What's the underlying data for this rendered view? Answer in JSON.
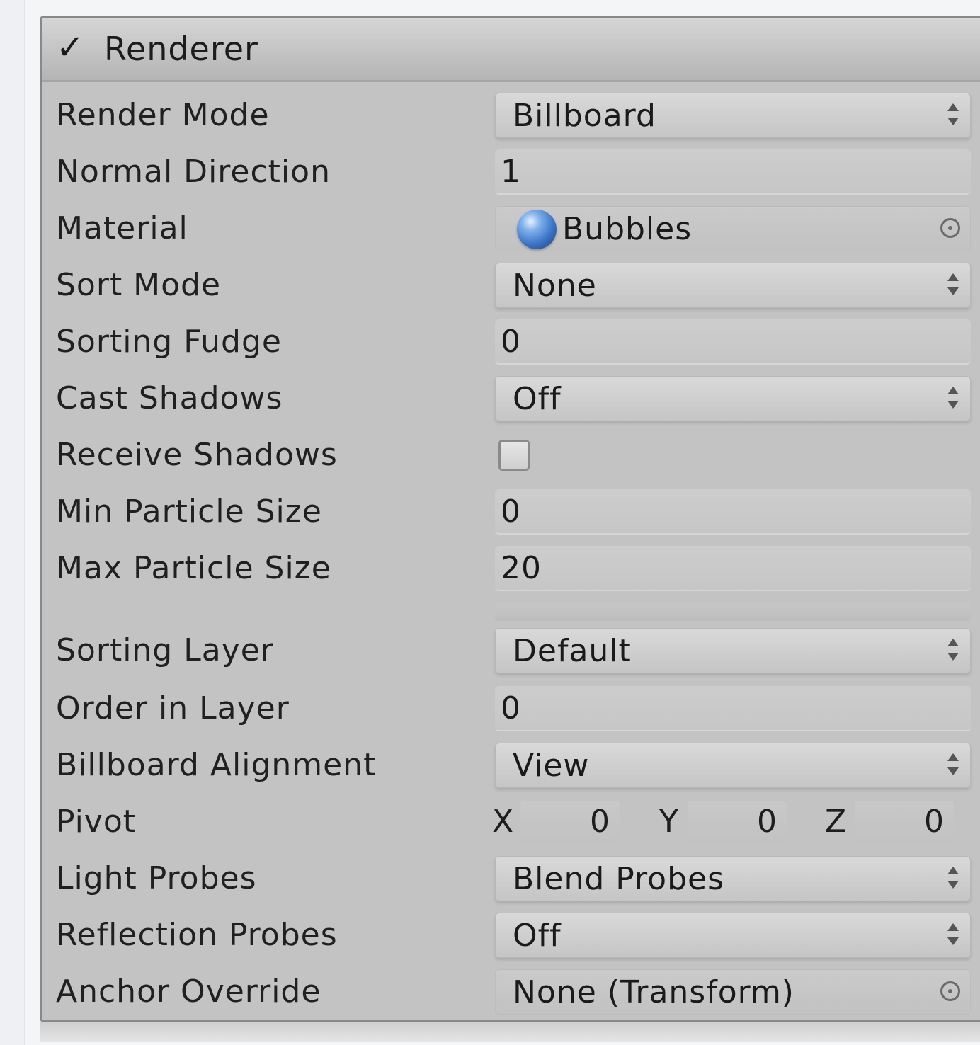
{
  "component": {
    "enabled_glyph": "✓",
    "title": "Renderer"
  },
  "rows": {
    "render_mode": {
      "label": "Render Mode",
      "value": "Billboard"
    },
    "normal_direction": {
      "label": "Normal Direction",
      "value": "1"
    },
    "material": {
      "label": "Material",
      "value": "Bubbles"
    },
    "sort_mode": {
      "label": "Sort Mode",
      "value": "None"
    },
    "sorting_fudge": {
      "label": "Sorting Fudge",
      "value": "0"
    },
    "cast_shadows": {
      "label": "Cast Shadows",
      "value": "Off"
    },
    "receive_shadows": {
      "label": "Receive Shadows",
      "checked": false
    },
    "min_particle_size": {
      "label": "Min Particle Size",
      "value": "0"
    },
    "max_particle_size": {
      "label": "Max Particle Size",
      "value": "20"
    },
    "sorting_layer": {
      "label": "Sorting Layer",
      "value": "Default"
    },
    "order_in_layer": {
      "label": "Order in Layer",
      "value": "0"
    },
    "billboard_alignment": {
      "label": "Billboard Alignment",
      "value": "View"
    },
    "pivot": {
      "label": "Pivot",
      "x_label": "X",
      "x": "0",
      "y_label": "Y",
      "y": "0",
      "z_label": "Z",
      "z": "0"
    },
    "light_probes": {
      "label": "Light Probes",
      "value": "Blend Probes"
    },
    "reflection_probes": {
      "label": "Reflection Probes",
      "value": "Off"
    },
    "anchor_override": {
      "label": "Anchor Override",
      "value": "None (Transform)"
    }
  },
  "icons": {
    "popup_arrows": "updown-arrows-icon",
    "object_picker": "object-picker-icon",
    "material_preview": "material-sphere-icon"
  },
  "colors": {
    "panel_bg": "#c3c3c3",
    "header_bg": "#c5c5c5",
    "material_sphere": "#3b74c7"
  }
}
